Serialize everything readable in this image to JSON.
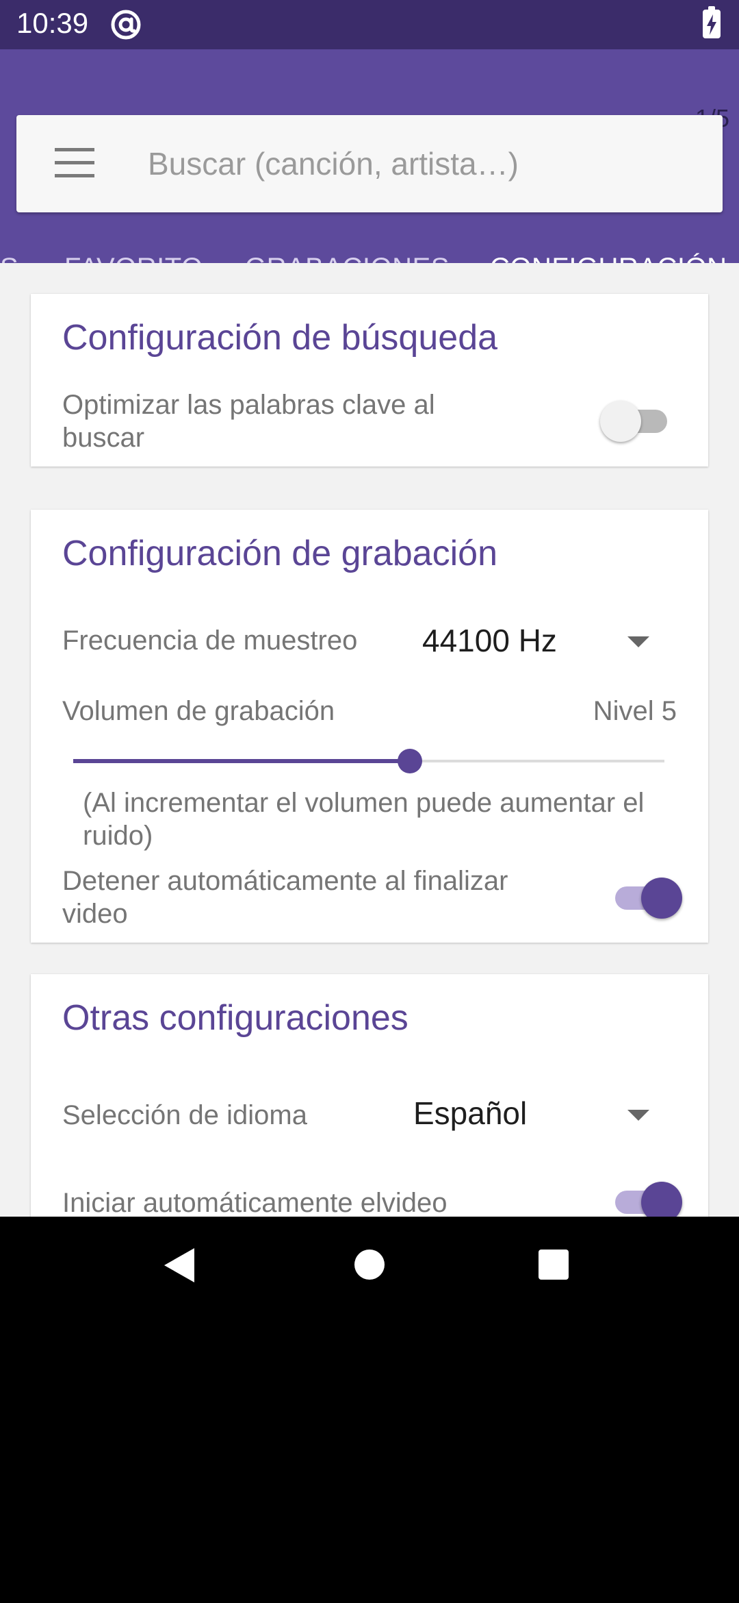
{
  "status_bar": {
    "time": "10:39",
    "at_icon": "at-sign-icon",
    "battery_icon": "battery-charging-icon"
  },
  "app_bar": {
    "page_indicator": "1/5",
    "search": {
      "placeholder": "Buscar (canción, artista…)",
      "value": ""
    },
    "menu_icon": "hamburger-menu-icon",
    "tabs": [
      {
        "label": "S",
        "active": false
      },
      {
        "label": "FAVORITO",
        "active": false
      },
      {
        "label": "GRABACIONES",
        "active": false
      },
      {
        "label": "CONFIGURACIÓN",
        "active": true
      }
    ]
  },
  "cards": {
    "search_settings": {
      "title": "Configuración de búsqueda",
      "optimize_keywords": {
        "label": "Optimizar las palabras clave al buscar",
        "enabled": false
      }
    },
    "recording_settings": {
      "title": "Configuración de grabación",
      "sample_rate": {
        "label": "Frecuencia de muestreo",
        "value": "44100 Hz"
      },
      "recording_volume": {
        "label": "Volumen de grabación",
        "value_text": "Nivel 5",
        "fraction": 0.57
      },
      "volume_note": "(Al incrementar el volumen puede aumentar el ruido)",
      "auto_stop": {
        "label": "Detener automáticamente al finalizar video",
        "enabled": true
      }
    },
    "other_settings": {
      "title": "Otras configuraciones",
      "language": {
        "label": "Selección de idioma",
        "value": "Español"
      },
      "auto_start": {
        "label": "Iniciar automáticamente elvideo",
        "enabled": true
      }
    }
  },
  "colors": {
    "status_bar": "#3b2c6a",
    "app_bar": "#5d4a9c",
    "accent": "#5a4595",
    "background": "#f2f2f2"
  },
  "nav_bar": {
    "back_icon": "back-triangle-icon",
    "home_icon": "home-circle-icon",
    "recents_icon": "recents-square-icon"
  }
}
